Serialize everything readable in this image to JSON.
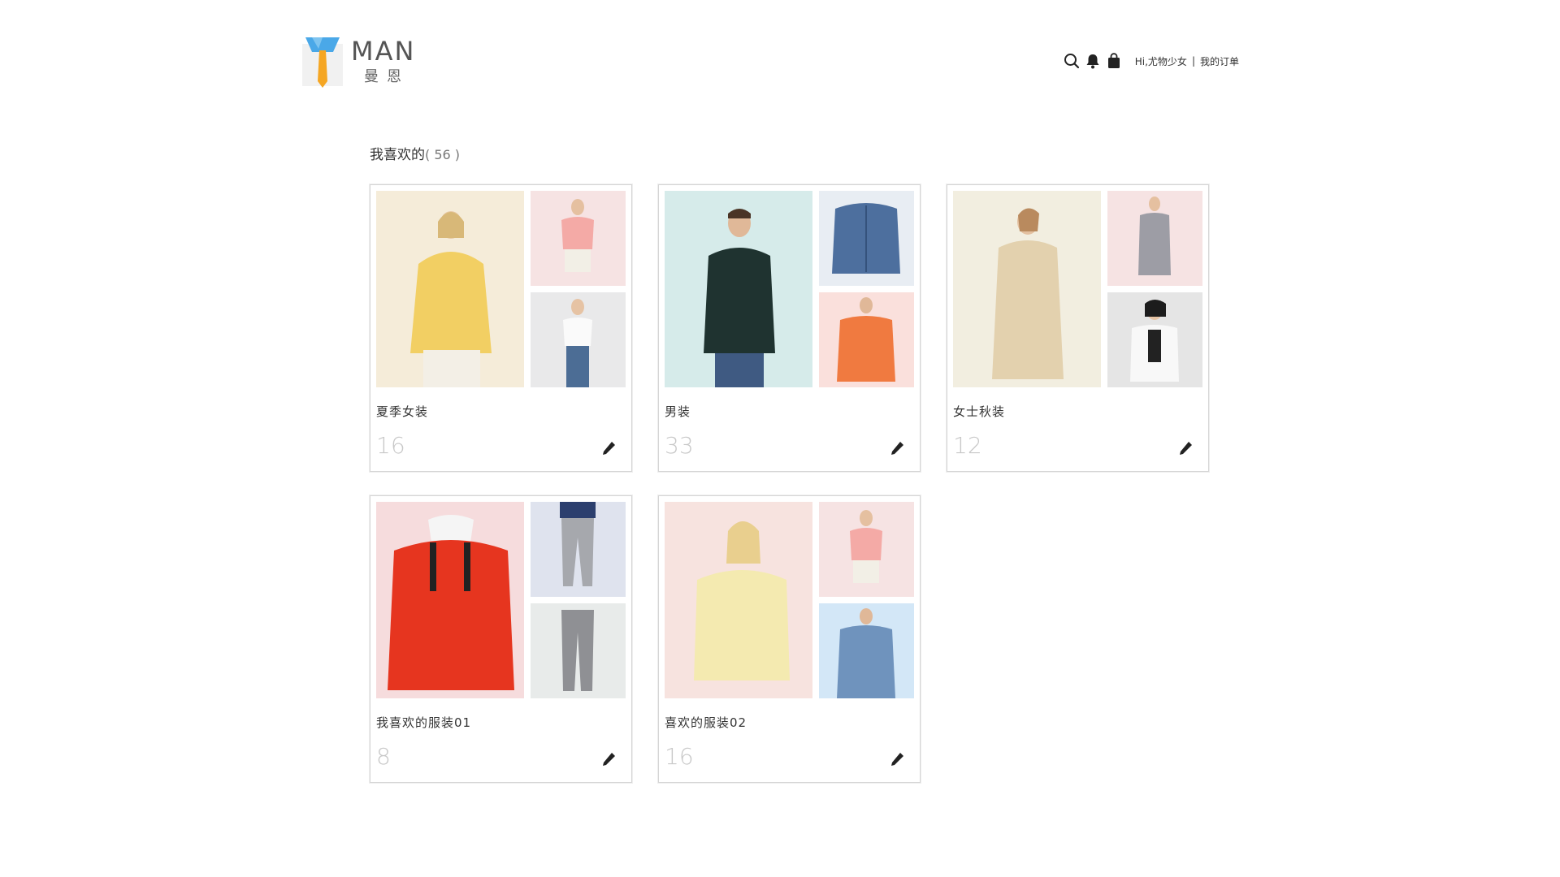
{
  "header": {
    "logo_text": "MAN",
    "logo_sub": "曼恩",
    "greeting": "Hi,尤物少女",
    "separator": "|",
    "orders_label": "我的订单",
    "icons": [
      "search-icon",
      "bell-icon",
      "shopping-bag-icon"
    ]
  },
  "section": {
    "title": "我喜欢的",
    "count": "( 56 )"
  },
  "collections": [
    {
      "name": "夏季女装",
      "count": "16"
    },
    {
      "name": "男装",
      "count": "33"
    },
    {
      "name": "女士秋装",
      "count": "12"
    },
    {
      "name": "我喜欢的服装01",
      "count": "8"
    },
    {
      "name": "喜欢的服装02",
      "count": "16"
    }
  ],
  "colors": {
    "accent_blue": "#4aa8e8",
    "tie_orange": "#f5a623",
    "count_gray": "#c8c8c8",
    "border": "#d5d5d5"
  }
}
